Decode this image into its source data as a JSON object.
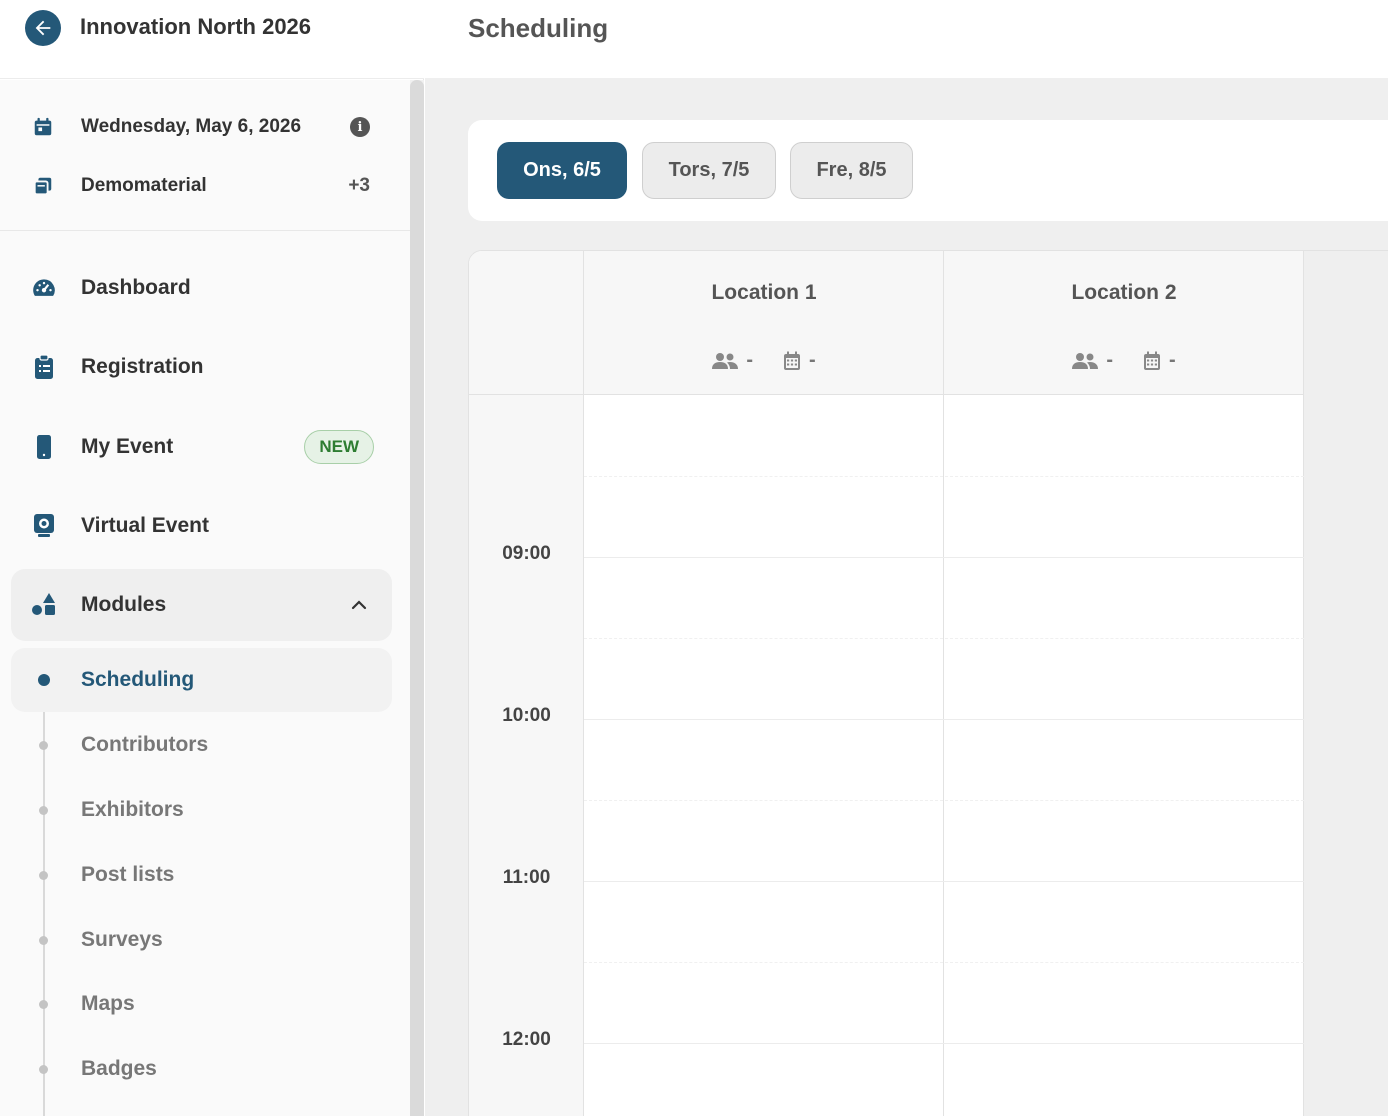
{
  "header": {
    "event_title": "Innovation North 2026",
    "page_title": "Scheduling"
  },
  "sidebar": {
    "date_label": "Wednesday, May 6, 2026",
    "material_label": "Demomaterial",
    "material_count": "+3",
    "nav": [
      {
        "label": "Dashboard",
        "icon": "gauge-icon"
      },
      {
        "label": "Registration",
        "icon": "clipboard-icon"
      },
      {
        "label": "My Event",
        "icon": "phone-icon",
        "badge": "NEW"
      },
      {
        "label": "Virtual Event",
        "icon": "webcam-icon"
      },
      {
        "label": "Modules",
        "icon": "shapes-icon",
        "expanded": true
      }
    ],
    "modules": [
      {
        "label": "Scheduling",
        "active": true
      },
      {
        "label": "Contributors"
      },
      {
        "label": "Exhibitors"
      },
      {
        "label": "Post lists"
      },
      {
        "label": "Surveys"
      },
      {
        "label": "Maps"
      },
      {
        "label": "Badges"
      }
    ]
  },
  "days": [
    {
      "label": "Ons, 6/5",
      "active": true
    },
    {
      "label": "Tors, 7/5",
      "active": false
    },
    {
      "label": "Fre, 8/5",
      "active": false
    }
  ],
  "locations": [
    {
      "name": "Location 1",
      "people": "-",
      "sessions": "-"
    },
    {
      "name": "Location 2",
      "people": "-",
      "sessions": "-"
    }
  ],
  "times": [
    "09:00",
    "10:00",
    "11:00",
    "12:00"
  ],
  "colors": {
    "primary": "#245878",
    "badge_green": "#2e7d32",
    "badge_bg": "#e6f2e6"
  }
}
